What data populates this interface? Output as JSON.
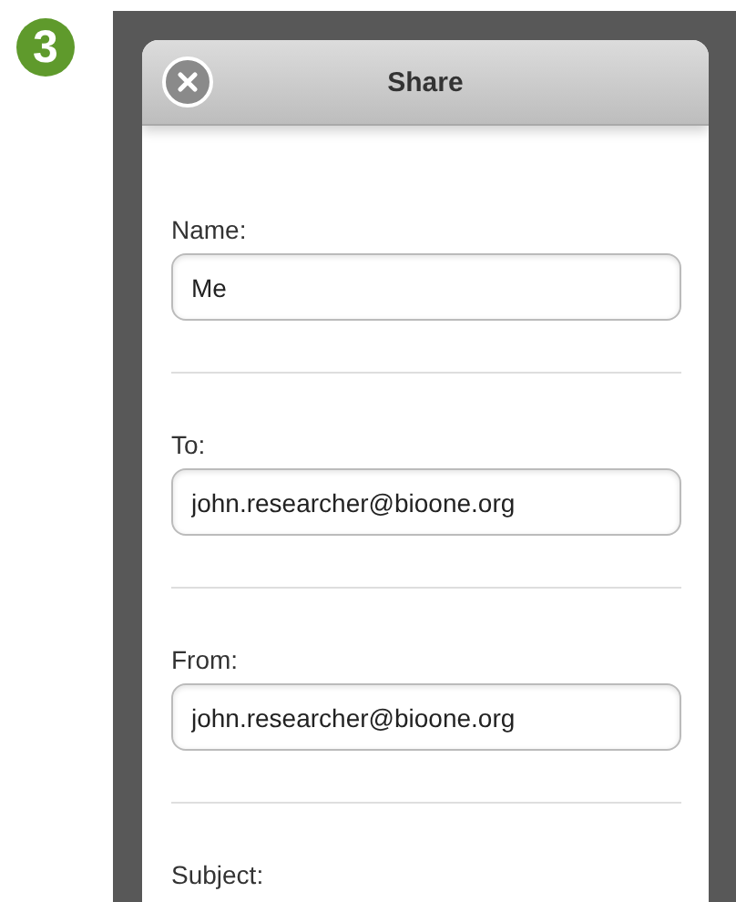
{
  "step_badge": "3",
  "dialog": {
    "title": "Share"
  },
  "fields": [
    {
      "label": "Name:",
      "value": "Me"
    },
    {
      "label": "To:",
      "value": "john.researcher@bioone.org"
    },
    {
      "label": "From:",
      "value": "john.researcher@bioone.org"
    },
    {
      "label": "Subject:"
    }
  ]
}
